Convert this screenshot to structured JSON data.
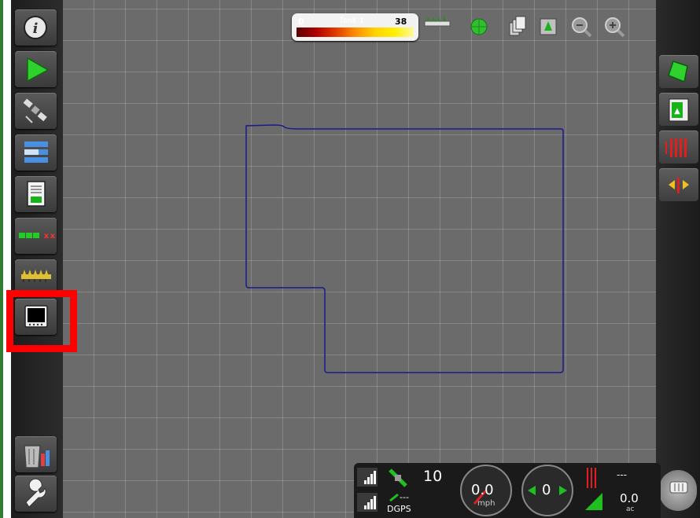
{
  "toolbar": {
    "tank_min": "0",
    "tank_title": "Tank 1",
    "tank_max": "38"
  },
  "status": {
    "satellite_count": "10",
    "correction_value": "---",
    "gps_mode": "DGPS",
    "speed_value": "0.0",
    "speed_unit": "mph",
    "sections_value": "0",
    "rate_value": "---",
    "area_value": "0.0",
    "area_unit": "ac"
  },
  "colors": {
    "highlight": "#ff0000",
    "boundary": "#1a1a8c",
    "accent_green": "#2e7d32"
  },
  "icons": {
    "left": [
      "info-icon",
      "guidance-arrow-icon",
      "satellite-icon",
      "list-setup-icon",
      "document-icon",
      "sections-icon",
      "implement-icon",
      "video-icon",
      "trash-users-icon",
      "wrench-icon"
    ],
    "right": [
      "field-icon",
      "field-page-icon",
      "rate-red-bars-icon",
      "pan-arrows-icon",
      "keyboard-dial-icon"
    ]
  }
}
